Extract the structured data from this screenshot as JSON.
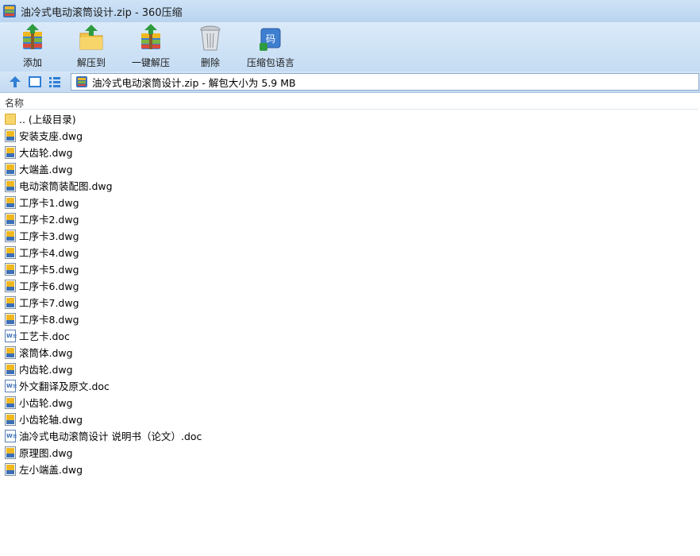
{
  "window": {
    "title": "油冷式电动滚筒设计.zip - 360压缩"
  },
  "toolbar": {
    "items": [
      {
        "label": "添加",
        "icon": "add-archive-icon"
      },
      {
        "label": "解压到",
        "icon": "extract-to-icon"
      },
      {
        "label": "一键解压",
        "icon": "one-click-extract-icon"
      },
      {
        "label": "删除",
        "icon": "trash-icon"
      },
      {
        "label": "压缩包语言",
        "icon": "archive-language-icon"
      }
    ]
  },
  "nav": {
    "address": "油冷式电动滚筒设计.zip - 解包大小为 5.9 MB"
  },
  "list": {
    "column_name": "名称",
    "items": [
      {
        "name": ".. (上级目录)",
        "type": "folder"
      },
      {
        "name": "安装支座.dwg",
        "type": "dwg"
      },
      {
        "name": "大齿轮.dwg",
        "type": "dwg"
      },
      {
        "name": "大端盖.dwg",
        "type": "dwg"
      },
      {
        "name": "电动滚筒装配图.dwg",
        "type": "dwg"
      },
      {
        "name": "工序卡1.dwg",
        "type": "dwg"
      },
      {
        "name": "工序卡2.dwg",
        "type": "dwg"
      },
      {
        "name": "工序卡3.dwg",
        "type": "dwg"
      },
      {
        "name": "工序卡4.dwg",
        "type": "dwg"
      },
      {
        "name": "工序卡5.dwg",
        "type": "dwg"
      },
      {
        "name": "工序卡6.dwg",
        "type": "dwg"
      },
      {
        "name": "工序卡7.dwg",
        "type": "dwg"
      },
      {
        "name": "工序卡8.dwg",
        "type": "dwg"
      },
      {
        "name": "工艺卡.doc",
        "type": "doc"
      },
      {
        "name": "滚筒体.dwg",
        "type": "dwg"
      },
      {
        "name": "内齿轮.dwg",
        "type": "dwg"
      },
      {
        "name": "外文翻译及原文.doc",
        "type": "doc"
      },
      {
        "name": "小齿轮.dwg",
        "type": "dwg"
      },
      {
        "name": "小齿轮轴.dwg",
        "type": "dwg"
      },
      {
        "name": "油冷式电动滚筒设计 说明书（论文）.doc",
        "type": "doc"
      },
      {
        "name": "原理图.dwg",
        "type": "dwg"
      },
      {
        "name": "左小端盖.dwg",
        "type": "dwg"
      }
    ]
  }
}
